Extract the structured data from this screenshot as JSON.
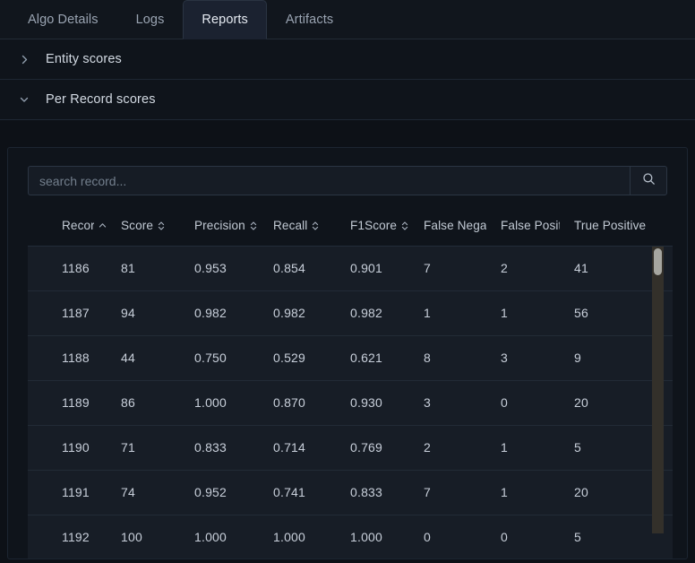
{
  "tabs": [
    {
      "label": "Algo Details",
      "active": false
    },
    {
      "label": "Logs",
      "active": false
    },
    {
      "label": "Reports",
      "active": true
    },
    {
      "label": "Artifacts",
      "active": false
    }
  ],
  "accordions": [
    {
      "label": "Entity scores",
      "expanded": false,
      "icon": "chevron-right-icon"
    },
    {
      "label": "Per Record scores",
      "expanded": true,
      "icon": "chevron-down-icon"
    }
  ],
  "search": {
    "placeholder": "search record...",
    "value": "",
    "button_icon": "search-icon"
  },
  "table": {
    "columns": [
      {
        "label": "Record ID",
        "sort": "asc"
      },
      {
        "label": "Score",
        "sort": "none"
      },
      {
        "label": "Precision",
        "sort": "none"
      },
      {
        "label": "Recall",
        "sort": "none"
      },
      {
        "label": "F1Score",
        "sort": "none"
      },
      {
        "label": "False Negative",
        "sort": "none"
      },
      {
        "label": "False Positive",
        "sort": "none"
      },
      {
        "label": "True Positive",
        "sort": "none"
      }
    ],
    "rows": [
      {
        "record_id": "1186",
        "score": "81",
        "precision": "0.953",
        "recall": "0.854",
        "f1score": "0.901",
        "false_negative": "7",
        "false_positive": "2",
        "true_positive": "41"
      },
      {
        "record_id": "1187",
        "score": "94",
        "precision": "0.982",
        "recall": "0.982",
        "f1score": "0.982",
        "false_negative": "1",
        "false_positive": "1",
        "true_positive": "56"
      },
      {
        "record_id": "1188",
        "score": "44",
        "precision": "0.750",
        "recall": "0.529",
        "f1score": "0.621",
        "false_negative": "8",
        "false_positive": "3",
        "true_positive": "9"
      },
      {
        "record_id": "1189",
        "score": "86",
        "precision": "1.000",
        "recall": "0.870",
        "f1score": "0.930",
        "false_negative": "3",
        "false_positive": "0",
        "true_positive": "20"
      },
      {
        "record_id": "1190",
        "score": "71",
        "precision": "0.833",
        "recall": "0.714",
        "f1score": "0.769",
        "false_negative": "2",
        "false_positive": "1",
        "true_positive": "5"
      },
      {
        "record_id": "1191",
        "score": "74",
        "precision": "0.952",
        "recall": "0.741",
        "f1score": "0.833",
        "false_negative": "7",
        "false_positive": "1",
        "true_positive": "20"
      },
      {
        "record_id": "1192",
        "score": "100",
        "precision": "1.000",
        "recall": "1.000",
        "f1score": "1.000",
        "false_negative": "0",
        "false_positive": "0",
        "true_positive": "5"
      }
    ]
  },
  "colors": {
    "page_background": "#0d1117",
    "row_background": "#171d26",
    "active_tab_background": "#1b2230",
    "text_primary": "#c8cfda",
    "text_muted": "#9aa4b2",
    "border": "#222c38",
    "scrollbar_track": "#33302a",
    "scrollbar_thumb": "#a6a6a0"
  }
}
